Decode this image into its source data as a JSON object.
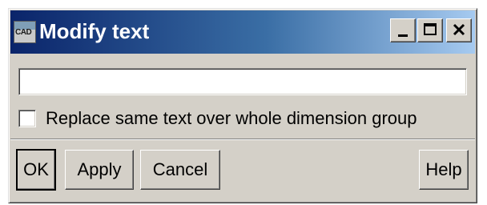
{
  "window": {
    "title": "Modify text",
    "app_icon_text": "CAD"
  },
  "titlebar_controls": {
    "minimize": "minimize",
    "maximize": "maximize",
    "close": "close"
  },
  "form": {
    "text_value": "",
    "replace_checkbox": {
      "label": "Replace same text over whole dimension group",
      "checked": false
    }
  },
  "buttons": {
    "ok": "OK",
    "apply": "Apply",
    "cancel": "Cancel",
    "help": "Help"
  },
  "colors": {
    "titlebar_start": "#0a246a",
    "titlebar_end": "#a6caf0",
    "face": "#d4d0c8"
  }
}
